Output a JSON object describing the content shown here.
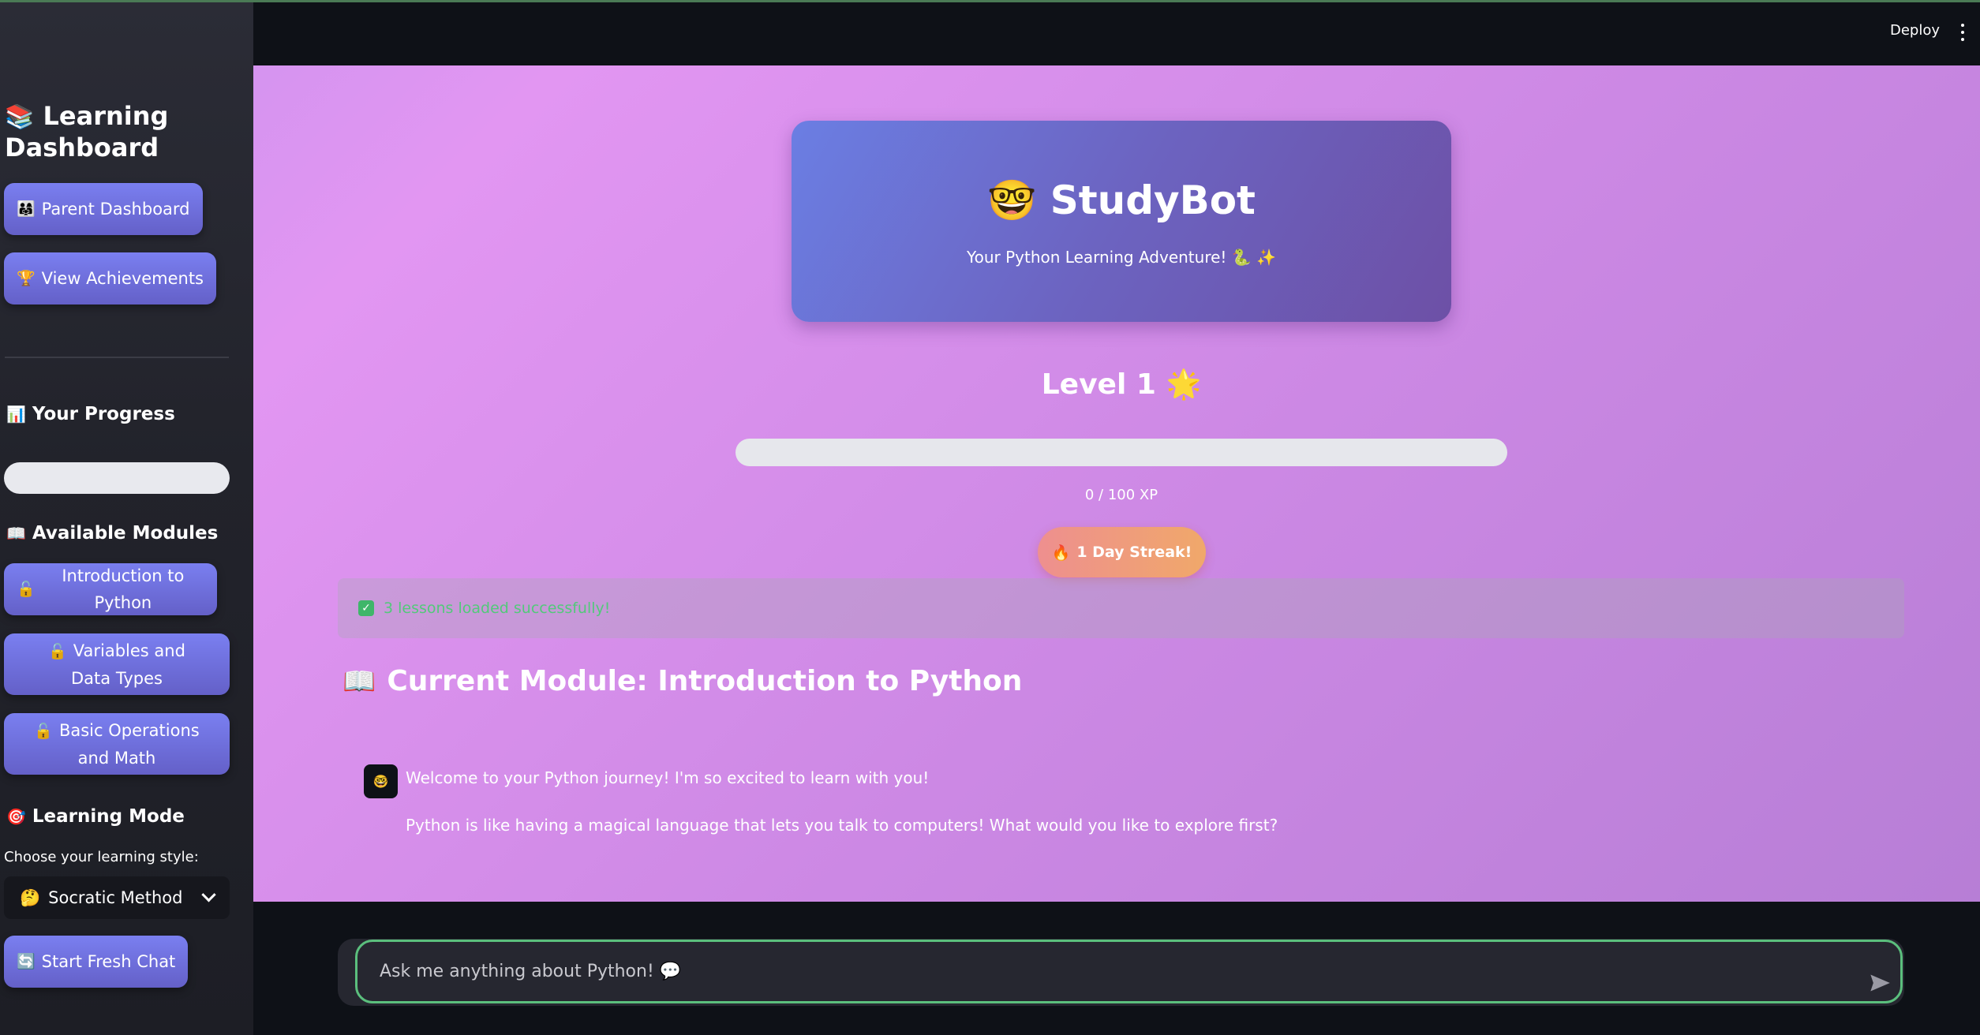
{
  "header": {
    "deploy_label": "Deploy",
    "menu_icon": "kebab-menu-icon"
  },
  "sidebar": {
    "title_icon": "📚",
    "title": "Learning Dashboard",
    "buttons": [
      {
        "icon": "👨‍👩‍👧",
        "label": "Parent Dashboard"
      },
      {
        "icon": "🏆",
        "label": "View Achievements"
      }
    ],
    "progress": {
      "icon": "📊",
      "heading": "Your Progress",
      "value": 0
    },
    "modules": {
      "icon": "📖",
      "heading": "Available Modules",
      "items": [
        {
          "icon": "🔓",
          "label": "Introduction to Python"
        },
        {
          "icon": "🔓",
          "label": "Variables and Data Types"
        },
        {
          "icon": "🔓",
          "label": "Basic Operations and Math"
        }
      ]
    },
    "learning_mode": {
      "icon": "🎯",
      "heading": "Learning Mode",
      "label": "Choose your learning style:",
      "selected_icon": "🤔",
      "selected": "Socratic Method"
    },
    "fresh_chat": {
      "icon": "🔄",
      "label": "Start Fresh Chat"
    }
  },
  "hero": {
    "icon": "🤓",
    "title": "StudyBot",
    "subtitle": "Your Python Learning Adventure! 🐍 ✨"
  },
  "level": {
    "label": "Level 1",
    "icon": "🌟",
    "xp_current": 0,
    "xp_max": 100,
    "xp_text": "0 / 100 XP"
  },
  "streak": {
    "icon": "🔥",
    "label": "1 Day Streak!"
  },
  "alert": {
    "text": "3 lessons loaded successfully!"
  },
  "module": {
    "icon": "📖",
    "title": "Current Module: Introduction to Python"
  },
  "chat": {
    "avatar": "🤓",
    "messages": [
      "Welcome to your Python journey! I'm so excited to learn with you!",
      "Python is like having a magical language that lets you talk to computers! What would you like to explore first?"
    ],
    "input_placeholder": "Ask me anything about Python! 💬",
    "colors": {
      "focus_border": "#5bbf7d"
    }
  },
  "colors": {
    "button_gradient_top": "#7a7ff0",
    "button_gradient_bottom": "#6460c8",
    "main_gradient": "#e296f2",
    "success_text": "#52c97a"
  }
}
